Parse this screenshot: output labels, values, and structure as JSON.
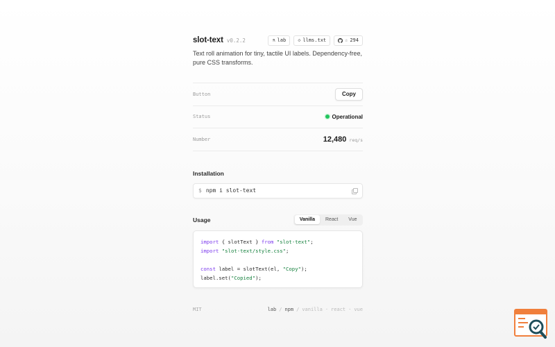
{
  "header": {
    "title": "slot-text",
    "version": "v0.2.2",
    "pills": [
      {
        "icon": "flask-icon",
        "glyph": "⚗",
        "label": "lab"
      },
      {
        "icon": "diamond-icon",
        "glyph": "◇",
        "label": "llms.txt"
      },
      {
        "icon": "github-icon",
        "glyph": "☆",
        "label": "294"
      }
    ]
  },
  "description": "Text roll animation for tiny, tactile UI labels. Dependency-free, pure CSS transforms.",
  "demo": {
    "button_label": "Button",
    "button_text": "Copy",
    "status_label": "Status",
    "status_text": "Operational",
    "status_color": "#22c55e",
    "number_label": "Number",
    "number_value": "12,480",
    "number_unit": "req/s"
  },
  "installation": {
    "title": "Installation",
    "prompt": "$",
    "command": "npm i slot-text"
  },
  "usage": {
    "title": "Usage",
    "tabs": [
      "Vanilla",
      "React",
      "Vue"
    ],
    "active_tab": "Vanilla",
    "code": {
      "l1_kw1": "import",
      "l1_a": " { slotText } ",
      "l1_kw2": "from",
      "l1_sp": " ",
      "l1_str": "\"slot-text\"",
      "l1_end": ";",
      "l2_kw": "import",
      "l2_sp": " ",
      "l2_str": "\"slot-text/style.css\"",
      "l2_end": ";",
      "l4_kw": "const",
      "l4_a": " label = slotText(el, ",
      "l4_str": "\"Copy\"",
      "l4_end": ");",
      "l5_a": "label.set(",
      "l5_str": "\"Copied\"",
      "l5_end": ");"
    }
  },
  "footer": {
    "license": "MIT",
    "links": [
      "lab",
      "npm",
      "vanilla",
      "react",
      "vue"
    ],
    "separators": [
      "/",
      "/",
      "·",
      "·"
    ]
  },
  "colors": {
    "accent_keyword": "#7c3aed",
    "accent_string": "#15803d",
    "status_ok": "#22c55e",
    "badge_orange": "#f07f3c",
    "badge_teal": "#1f4e5a"
  }
}
